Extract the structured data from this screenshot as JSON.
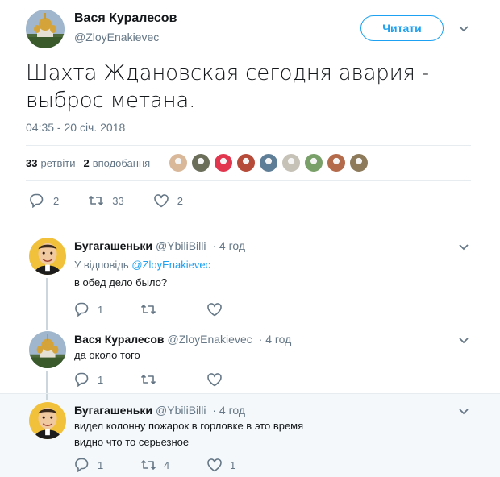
{
  "tweet": {
    "author_name": "Вася Куралесов",
    "author_handle": "@ZloyEnakievec",
    "follow_label": "Читати",
    "text_line1": "Шахта Ждановская сегодня авария -",
    "text_line2": "выброс метана.",
    "timestamp": "04:35 - 20 січ. 2018",
    "retweets_count": "33",
    "retweets_label": "ретвіти",
    "likes_count": "2",
    "likes_label": "вподобання",
    "liker_avatars": [
      "#d9b89a",
      "#6b6f5a",
      "#e2354e",
      "#b74b3a",
      "#5e7d97",
      "#c6c2b8",
      "#7aa06a",
      "#b46b4c",
      "#8c7a5a"
    ],
    "actions": {
      "replies": "2",
      "retweets": "33",
      "likes": "2"
    }
  },
  "replies": [
    {
      "name": "Бугагашеньки",
      "handle": "@YbiliBilli",
      "time": "· 4 год",
      "replying_prefix": "У відповідь",
      "replying_to": "@ZloyEnakievec",
      "text_lines": [
        "в обед дело было?"
      ],
      "actions": {
        "replies": "1",
        "retweets": "",
        "likes": ""
      }
    },
    {
      "name": "Вася Куралесов",
      "handle": "@ZloyEnakievec",
      "time": "· 4 год",
      "text_lines": [
        "да около того"
      ],
      "actions": {
        "replies": "1",
        "retweets": "",
        "likes": ""
      }
    },
    {
      "name": "Бугагашеньки",
      "handle": "@YbiliBilli",
      "time": "· 4 год",
      "text_lines": [
        "видел колонну пожарок в горловке в это время",
        "видно что то серьезное"
      ],
      "actions": {
        "replies": "1",
        "retweets": "4",
        "likes": "1"
      }
    }
  ],
  "colors": {
    "accent": "#1da1f2",
    "secondary_text": "#657786",
    "divider": "#e6ecf0",
    "highlight_bg": "#f5f8fa"
  }
}
